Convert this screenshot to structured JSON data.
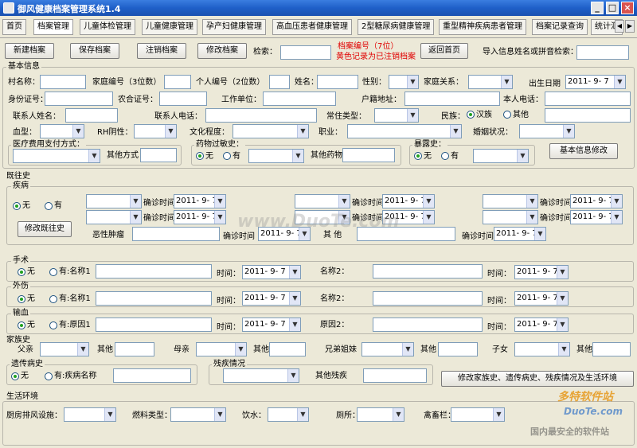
{
  "window": {
    "title": "御风健康档案管理系统1.4",
    "minimize": "_",
    "maximize": "□",
    "close": "×"
  },
  "tabs": [
    "首页",
    "档案管理",
    "儿童体检管理",
    "儿童健康管理",
    "孕产妇健康管理",
    "高血压患者健康管理",
    "2型糖尿病健康管理",
    "重型精神疾病患者管理",
    "档案记录查询",
    "统计汇"
  ],
  "scroll_arrows": {
    "left": "◀",
    "right": "▶"
  },
  "toolbar": {
    "new_label": "新建档案",
    "save_label": "保存档案",
    "cancel_label": "注销档案",
    "edit_label": "修改档案",
    "search_label": "检索：",
    "hint_line1": "档案编号（7位）",
    "hint_line2": "黄色记录为已注销档案",
    "back_label": "返回首页",
    "import_label": "导入信息姓名或拼音检索："
  },
  "basic": {
    "group_title": "基本信息",
    "village_label": "村名称：",
    "family_no_label": "家庭编号（3位数）",
    "person_no_label": "个人编号（2位数）",
    "name_label": "姓名：",
    "gender_label": "性别：",
    "relation_label": "家庭关系：",
    "birth_label": "出生日期",
    "birth_value": "2011- 9- 7",
    "id_label": "身份证号：",
    "farm_label": "农合证号：",
    "work_label": "工作单位：",
    "huji_label": "户籍地址：",
    "phone_label": "本人电话：",
    "contact_label": "联系人姓名：",
    "contact_phone_label": "联系人电话：",
    "resident_label": "常住类型：",
    "ethnic_label": "民族：",
    "ethnic_han": "汉族",
    "ethnic_other": "其他",
    "blood_label": "血型：",
    "rh_label": "RH阴性：",
    "edu_label": "文化程度：",
    "job_label": "职业：",
    "marriage_label": "婚姻状况：",
    "pay_title": "医疗费用支付方式：",
    "pay_other_label": "其他方式",
    "allergy_title": "药物过敏史：",
    "none": "无",
    "yes": "有",
    "allergy_other_label": "其他药物",
    "expose_title": "暴露史：",
    "modify_basic": "基本信息修改"
  },
  "history": {
    "group_title": "既往史",
    "disease_title": "疾病",
    "none": "无",
    "yes": "有",
    "modify_btn": "修改既往史",
    "diag_label": "确诊时间",
    "date": "2011- 9- 7",
    "tumor_label": "恶性肿瘤",
    "other_label": "其 他",
    "surgery_title": "手术",
    "surgery_yes": "有:名称1",
    "time_label": "时间：",
    "name2_label": "名称2：",
    "injury_title": "外伤",
    "transfusion_title": "输血",
    "transfusion_yes": "有:原因1",
    "reason2_label": "原因2："
  },
  "family": {
    "title": "家族史",
    "father": "父亲",
    "mother": "母亲",
    "sibling": "兄弟姐妹",
    "child": "子女",
    "other": "其他",
    "genetic_title": "遗传病史",
    "genetic_yes": "有:疾病名称",
    "disability_title": "残疾情况",
    "disability_other": "其他残疾",
    "modify_btn": "修改家族史、遗传病史、残疾情况及生活环境"
  },
  "living": {
    "title": "生活环境",
    "kitchen": "厨房排风设施：",
    "fuel": "燃料类型：",
    "water": "饮水：",
    "toilet": "厕所：",
    "livestock": "禽畜栏："
  },
  "watermarks": {
    "center": "www.DuoTe.com",
    "brand": "多特软件站",
    "brand_url": "DuoTe.com",
    "slogan": "国内最安全的软件站"
  }
}
